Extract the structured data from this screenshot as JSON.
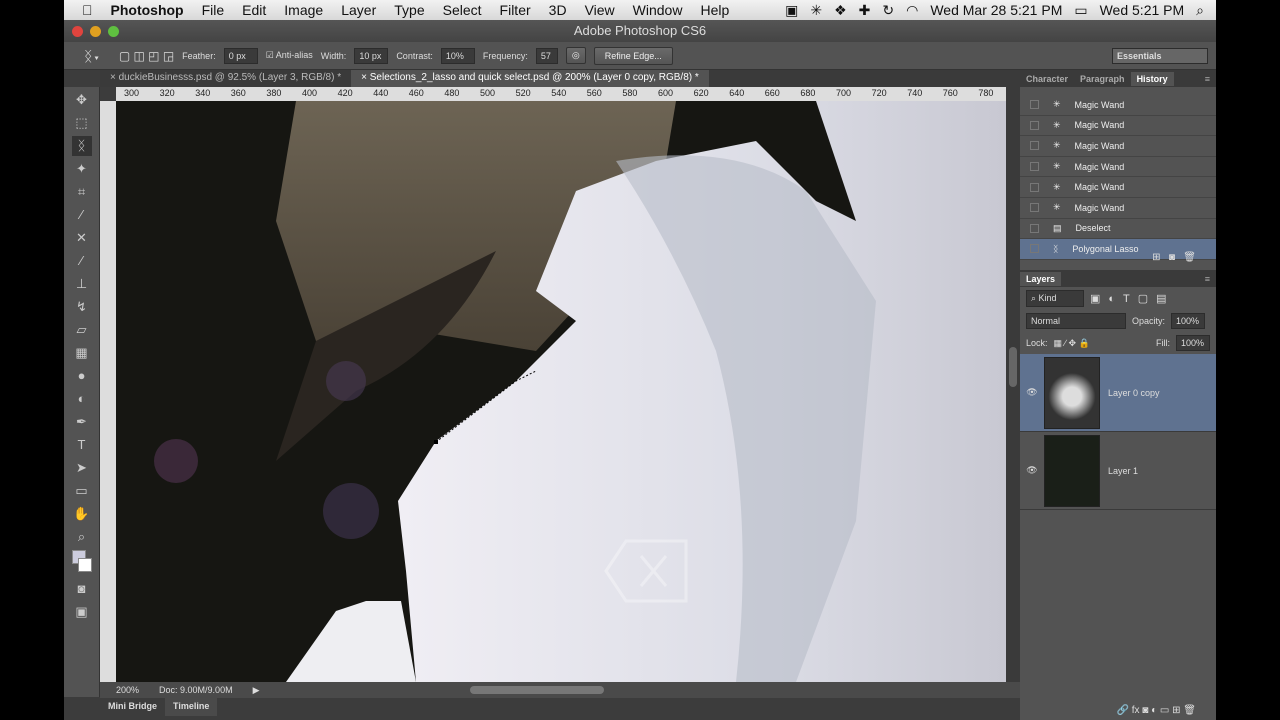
{
  "menubar": {
    "apple": "",
    "app": "Photoshop",
    "items": [
      "File",
      "Edit",
      "Image",
      "Layer",
      "Type",
      "Select",
      "Filter",
      "3D",
      "View",
      "Window",
      "Help"
    ],
    "clock1": "Wed Mar 28  5:21 PM",
    "clock2": "Wed 5:21 PM"
  },
  "window_title": "Adobe Photoshop CS6",
  "options": {
    "feather_label": "Feather:",
    "feather": "0 px",
    "antialias": "Anti-alias",
    "width_label": "Width:",
    "width": "10 px",
    "contrast_label": "Contrast:",
    "contrast": "10%",
    "frequency_label": "Frequency:",
    "frequency": "57",
    "refine_edge": "Refine Edge...",
    "workspace": "Essentials"
  },
  "tabs": [
    {
      "label": "duckieBusinesss.psd @ 92.5% (Layer 3, RGB/8) *"
    },
    {
      "label": "Selections_2_lasso and quick select.psd @ 200% (Layer 0 copy, RGB/8) *"
    }
  ],
  "ruler": [
    "300",
    "320",
    "340",
    "360",
    "380",
    "400",
    "420",
    "440",
    "460",
    "480",
    "500",
    "520",
    "540",
    "560",
    "580",
    "600",
    "620",
    "640",
    "660",
    "680",
    "700",
    "720",
    "740",
    "760",
    "780"
  ],
  "status": {
    "zoom": "200%",
    "doc": "Doc: 9.00M/9.00M"
  },
  "bottom_tabs": [
    "Mini Bridge",
    "Timeline"
  ],
  "panel_tabs": [
    "Character",
    "Paragraph",
    "History"
  ],
  "history": [
    "Magic Wand",
    "Magic Wand",
    "Magic Wand",
    "Magic Wand",
    "Magic Wand",
    "Magic Wand",
    "Deselect",
    "Polygonal Lasso"
  ],
  "layers": {
    "title": "Layers",
    "kind": "Kind",
    "blend": "Normal",
    "opacity_label": "Opacity:",
    "opacity": "100%",
    "lock_label": "Lock:",
    "fill_label": "Fill:",
    "fill": "100%",
    "items": [
      "Layer 0 copy",
      "Layer 1"
    ]
  }
}
